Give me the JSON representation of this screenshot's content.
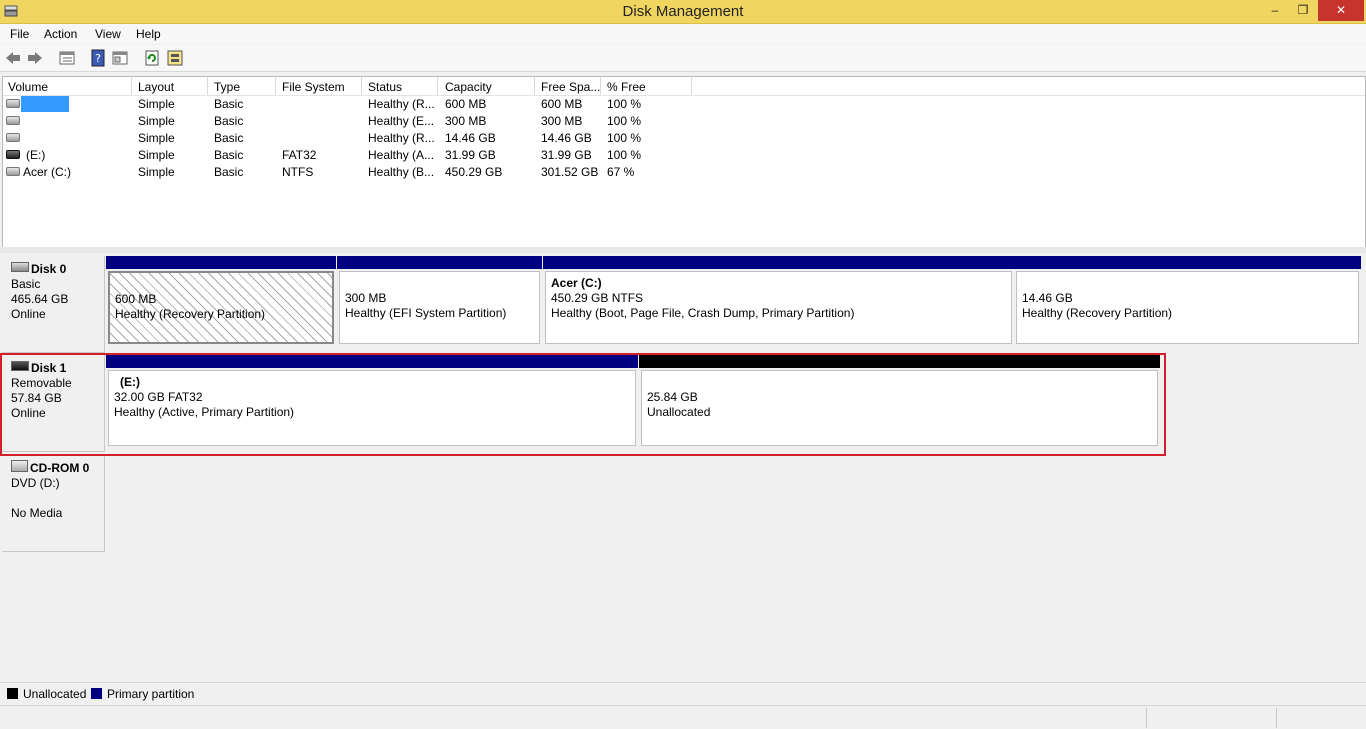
{
  "window": {
    "title": "Disk Management",
    "minimize": "–",
    "maximize": "❐",
    "close": "✕"
  },
  "menu": [
    "File",
    "Action",
    "View",
    "Help"
  ],
  "toolbar": [
    "back-icon",
    "forward-icon",
    "list-view-icon",
    "help-icon",
    "properties-icon",
    "refresh-icon",
    "rescan-icon"
  ],
  "volume_list": {
    "columns": [
      "Volume",
      "Layout",
      "Type",
      "File System",
      "Status",
      "Capacity",
      "Free Spa...",
      "% Free"
    ],
    "rows": [
      {
        "volume": "",
        "layout": "Simple",
        "type": "Basic",
        "fs": "",
        "status": "Healthy (R...",
        "capacity": "600 MB",
        "free": "600 MB",
        "pct": "100 %"
      },
      {
        "volume": "",
        "layout": "Simple",
        "type": "Basic",
        "fs": "",
        "status": "Healthy (E...",
        "capacity": "300 MB",
        "free": "300 MB",
        "pct": "100 %"
      },
      {
        "volume": "",
        "layout": "Simple",
        "type": "Basic",
        "fs": "",
        "status": "Healthy (R...",
        "capacity": "14.46 GB",
        "free": "14.46 GB",
        "pct": "100 %"
      },
      {
        "volume": "(E:)",
        "layout": "Simple",
        "type": "Basic",
        "fs": "FAT32",
        "status": "Healthy (A...",
        "capacity": "31.99 GB",
        "free": "31.99 GB",
        "pct": "100 %"
      },
      {
        "volume": "Acer (C:)",
        "layout": "Simple",
        "type": "Basic",
        "fs": "NTFS",
        "status": "Healthy (B...",
        "capacity": "450.29 GB",
        "free": "301.52 GB",
        "pct": "67 %"
      }
    ]
  },
  "disks": [
    {
      "name": "Disk 0",
      "kind": "Basic",
      "size": "465.64 GB",
      "state": "Online",
      "partitions": [
        {
          "title": "",
          "line1": "600 MB",
          "line2": "Healthy (Recovery Partition)"
        },
        {
          "title": "",
          "line1": "300 MB",
          "line2": "Healthy (EFI System Partition)"
        },
        {
          "title": "Acer  (C:)",
          "line1": "450.29 GB NTFS",
          "line2": "Healthy (Boot, Page File, Crash Dump, Primary Partition)"
        },
        {
          "title": "",
          "line1": "14.46 GB",
          "line2": "Healthy (Recovery Partition)"
        }
      ]
    },
    {
      "name": "Disk 1",
      "kind": "Removable",
      "size": "57.84 GB",
      "state": "Online",
      "partitions": [
        {
          "title": "(E:)",
          "line1": "32.00 GB FAT32",
          "line2": "Healthy (Active, Primary Partition)"
        },
        {
          "title": "",
          "line1": "25.84 GB",
          "line2": "Unallocated"
        }
      ]
    },
    {
      "name": "CD-ROM 0",
      "kind": "DVD (D:)",
      "size": "",
      "state": "No Media",
      "partitions": []
    }
  ],
  "legend": [
    {
      "label": "Unallocated",
      "color": "#000000"
    },
    {
      "label": "Primary partition",
      "color": "#000080"
    }
  ],
  "colors": {
    "titlebar": "#f0d660",
    "primary": "#000080",
    "unallocated": "#000000",
    "highlight": "#d3202a",
    "selection": "#3399ff"
  }
}
